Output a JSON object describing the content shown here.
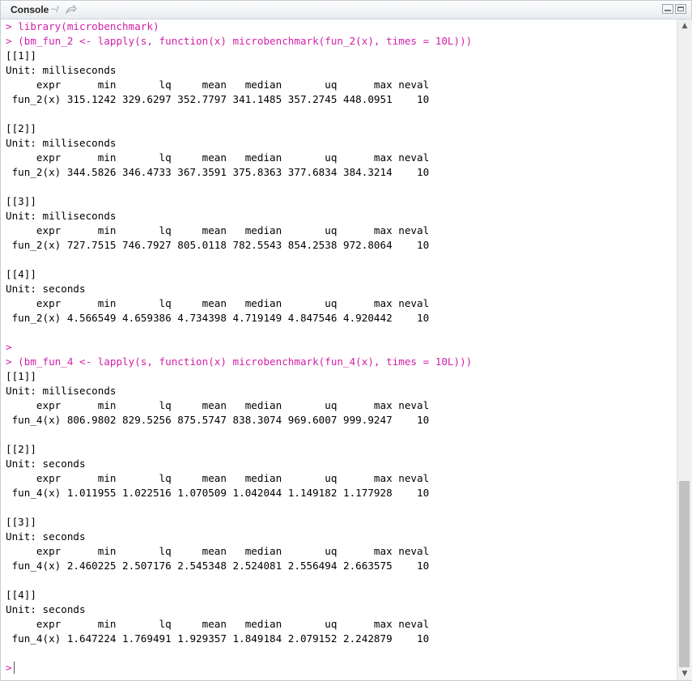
{
  "header": {
    "title": "Console",
    "path": "~/",
    "goto_icon": "arrow-out-icon",
    "minimize_icon": "minimize-icon",
    "maximize_icon": "maximize-icon"
  },
  "console": {
    "lines": [
      {
        "kind": "cmd",
        "text": "> library(microbenchmark)"
      },
      {
        "kind": "cmd",
        "text": "> (bm_fun_2 <- lapply(s, function(x) microbenchmark(fun_2(x), times = 10L)))"
      },
      {
        "kind": "out",
        "text": "[[1]]"
      },
      {
        "kind": "out",
        "text": "Unit: milliseconds"
      },
      {
        "kind": "out",
        "text": "     expr      min       lq     mean   median       uq      max neval"
      },
      {
        "kind": "out",
        "text": " fun_2(x) 315.1242 329.6297 352.7797 341.1485 357.2745 448.0951    10"
      },
      {
        "kind": "blank",
        "text": ""
      },
      {
        "kind": "out",
        "text": "[[2]]"
      },
      {
        "kind": "out",
        "text": "Unit: milliseconds"
      },
      {
        "kind": "out",
        "text": "     expr      min       lq     mean   median       uq      max neval"
      },
      {
        "kind": "out",
        "text": " fun_2(x) 344.5826 346.4733 367.3591 375.8363 377.6834 384.3214    10"
      },
      {
        "kind": "blank",
        "text": ""
      },
      {
        "kind": "out",
        "text": "[[3]]"
      },
      {
        "kind": "out",
        "text": "Unit: milliseconds"
      },
      {
        "kind": "out",
        "text": "     expr      min       lq     mean   median       uq      max neval"
      },
      {
        "kind": "out",
        "text": " fun_2(x) 727.7515 746.7927 805.0118 782.5543 854.2538 972.8064    10"
      },
      {
        "kind": "blank",
        "text": ""
      },
      {
        "kind": "out",
        "text": "[[4]]"
      },
      {
        "kind": "out",
        "text": "Unit: seconds"
      },
      {
        "kind": "out",
        "text": "     expr      min       lq     mean   median       uq      max neval"
      },
      {
        "kind": "out",
        "text": " fun_2(x) 4.566549 4.659386 4.734398 4.719149 4.847546 4.920442    10"
      },
      {
        "kind": "blank",
        "text": ""
      },
      {
        "kind": "cmd",
        "text": ">"
      },
      {
        "kind": "cmd",
        "text": "> (bm_fun_4 <- lapply(s, function(x) microbenchmark(fun_4(x), times = 10L)))"
      },
      {
        "kind": "out",
        "text": "[[1]]"
      },
      {
        "kind": "out",
        "text": "Unit: milliseconds"
      },
      {
        "kind": "out",
        "text": "     expr      min       lq     mean   median       uq      max neval"
      },
      {
        "kind": "out",
        "text": " fun_4(x) 806.9802 829.5256 875.5747 838.3074 969.6007 999.9247    10"
      },
      {
        "kind": "blank",
        "text": ""
      },
      {
        "kind": "out",
        "text": "[[2]]"
      },
      {
        "kind": "out",
        "text": "Unit: seconds"
      },
      {
        "kind": "out",
        "text": "     expr      min       lq     mean   median       uq      max neval"
      },
      {
        "kind": "out",
        "text": " fun_4(x) 1.011955 1.022516 1.070509 1.042044 1.149182 1.177928    10"
      },
      {
        "kind": "blank",
        "text": ""
      },
      {
        "kind": "out",
        "text": "[[3]]"
      },
      {
        "kind": "out",
        "text": "Unit: seconds"
      },
      {
        "kind": "out",
        "text": "     expr      min       lq     mean   median       uq      max neval"
      },
      {
        "kind": "out",
        "text": " fun_4(x) 2.460225 2.507176 2.545348 2.524081 2.556494 2.663575    10"
      },
      {
        "kind": "blank",
        "text": ""
      },
      {
        "kind": "out",
        "text": "[[4]]"
      },
      {
        "kind": "out",
        "text": "Unit: seconds"
      },
      {
        "kind": "out",
        "text": "     expr      min       lq     mean   median       uq      max neval"
      },
      {
        "kind": "out",
        "text": " fun_4(x) 1.647224 1.769491 1.929357 1.849184 2.079152 2.242879    10"
      },
      {
        "kind": "blank",
        "text": ""
      }
    ],
    "prompt": ">"
  },
  "scrollbar": {
    "up_arrow": "▲",
    "down_arrow": "▼"
  },
  "colors": {
    "command": "#d11fa8",
    "output": "#000000"
  }
}
